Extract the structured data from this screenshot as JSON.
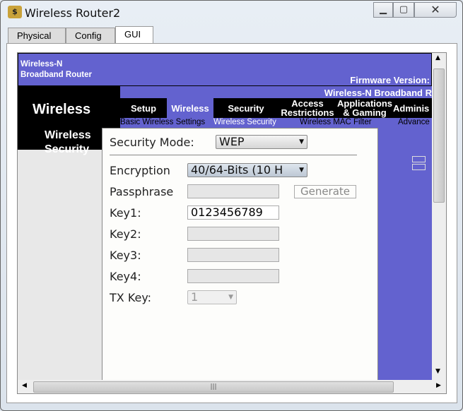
{
  "window": {
    "title": "Wireless Router2",
    "icon": "packet-tracer-router-icon",
    "minimize": "minimize-icon",
    "maximize": "maximize-icon",
    "close": "close-icon"
  },
  "tabs": [
    {
      "label": "Physical"
    },
    {
      "label": "Config"
    },
    {
      "label": "GUI",
      "active": true
    }
  ],
  "router": {
    "brand_line1": "Wireless-N",
    "brand_line2": "Broadband Router",
    "firmware": "Firmware Version:",
    "model": "Wireless-N Broadband R",
    "section": "Wireless",
    "subsection": "Wireless Security"
  },
  "nav": [
    {
      "label": "Setup"
    },
    {
      "label": "Wireless",
      "active": true
    },
    {
      "label": "Security"
    },
    {
      "label": "Access Restrictions"
    },
    {
      "label": "Applications & Gaming"
    },
    {
      "label": "Adminis"
    }
  ],
  "subnav": [
    {
      "label": "Basic Wireless Settings"
    },
    {
      "label": "Wireless Security",
      "active": true
    },
    {
      "label": "Wireless MAC Filter"
    },
    {
      "label": "Advance"
    }
  ],
  "form": {
    "security_mode_label": "Security Mode:",
    "security_mode_value": "WEP",
    "encryption_label": "Encryption",
    "encryption_value": "40/64-Bits (10 H",
    "passphrase_label": "Passphrase",
    "passphrase_value": "",
    "generate_label": "Generate",
    "key1_label": "Key1:",
    "key1_value": "0123456789",
    "key2_label": "Key2:",
    "key3_label": "Key3:",
    "key4_label": "Key4:",
    "txkey_label": "TX Key:",
    "txkey_value": "1"
  },
  "colors": {
    "accent_purple": "#6362cf",
    "nav_black": "#000000"
  }
}
